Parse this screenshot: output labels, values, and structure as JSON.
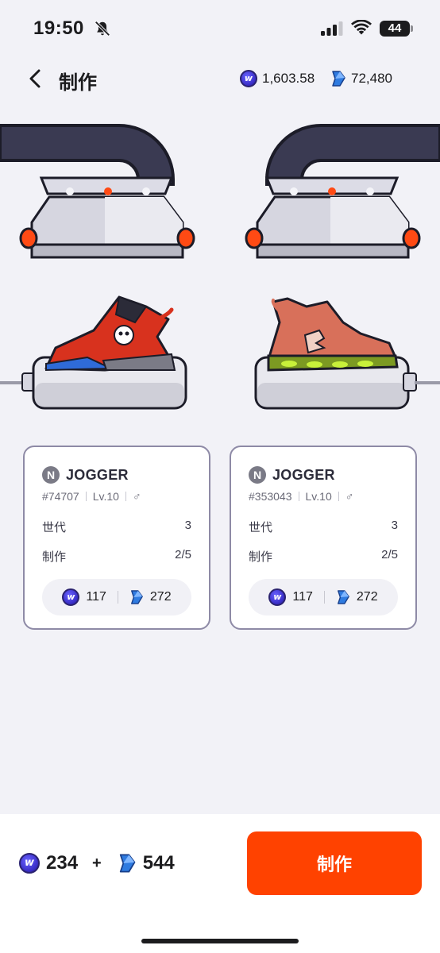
{
  "status_bar": {
    "time": "19:50",
    "battery": "44",
    "icons": [
      "bell-slash-icon",
      "signal-icon",
      "wifi-icon",
      "battery-icon"
    ]
  },
  "header": {
    "title": "制作",
    "back_icon": "chevron-left-icon",
    "token_balance": "1,603.58",
    "gem_balance": "72,480"
  },
  "parents": [
    {
      "type_badge": "N",
      "type": "JOGGER",
      "id": "#74707",
      "level": "Lv.10",
      "gender_icon": "♂",
      "generation_label": "世代",
      "generation_value": "3",
      "mint_label": "制作",
      "mint_value": "2/5",
      "cost_token": "117",
      "cost_gem": "272",
      "shoe_color": "#d8321e"
    },
    {
      "type_badge": "N",
      "type": "JOGGER",
      "id": "#353043",
      "level": "Lv.10",
      "gender_icon": "♂",
      "generation_label": "世代",
      "generation_value": "3",
      "mint_label": "制作",
      "mint_value": "2/5",
      "cost_token": "117",
      "cost_gem": "272",
      "shoe_color": "#d8705a"
    }
  ],
  "footer": {
    "total_token": "234",
    "plus": "+",
    "total_gem": "544",
    "mint_button_label": "制作"
  },
  "colors": {
    "accent": "#ff4200",
    "background": "#f2f2f7",
    "machine_pipe": "#3a3a52",
    "card_border": "#8e8aa6"
  }
}
